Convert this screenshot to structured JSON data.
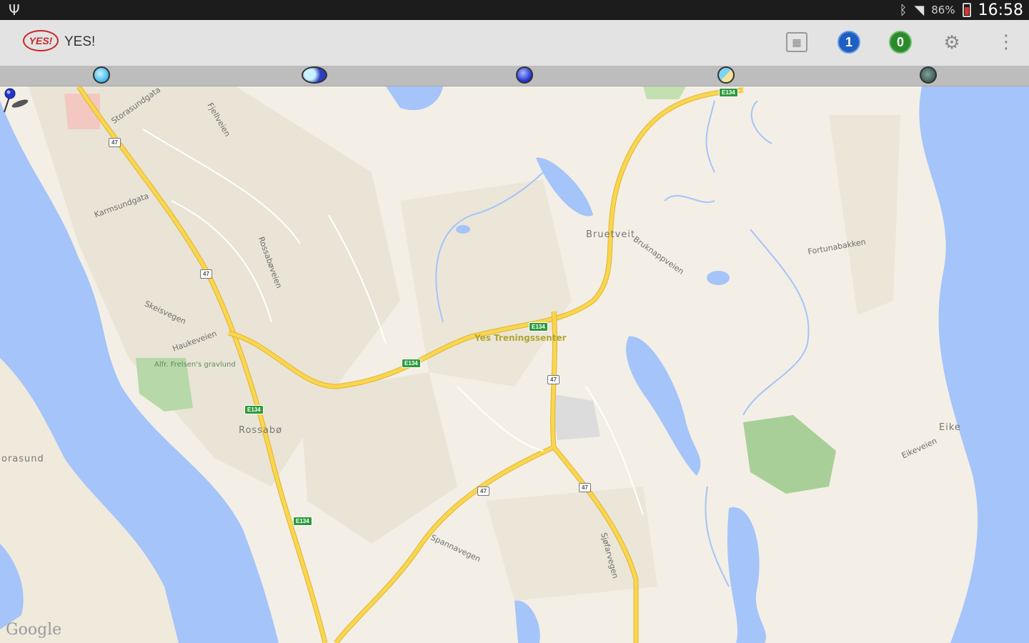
{
  "status_bar": {
    "usb_icon": "usb-icon",
    "bluetooth_icon": "bluetooth-icon",
    "wifi_icon": "wifi-icon",
    "battery_percent": "86%",
    "time": "16:58"
  },
  "action_bar": {
    "logo_text": "YES!",
    "title": "YES!",
    "blue_count": "1",
    "green_count": "0",
    "icons": [
      "chart-icon",
      "gear-icon",
      "overflow-menu-icon"
    ]
  },
  "map": {
    "places": {
      "bruetveit": "Bruetveit",
      "rossabo": "Rossabø",
      "eike": "Eike",
      "karmsund": "orasund"
    },
    "poi": "Yes Treningssenter",
    "park": "Alfr. Frelsen's gravlund",
    "streets": [
      "Storasundgata",
      "Karmsundgata",
      "Fjellveien",
      "Haukeveien",
      "Skeisvegen",
      "Rossabøveien",
      "Spannavegen",
      "Eikeveien",
      "Bruknappveien",
      "Sjøfarvegen",
      "Fortunabakken"
    ],
    "shields": [
      "E134",
      "47",
      "47",
      "E134",
      "E134",
      "E134",
      "47",
      "47",
      "47",
      "E134"
    ],
    "attribution": "Google"
  },
  "colors": {
    "water": "#a5c4f9",
    "land": "#f3efe6",
    "road": "#f9d650",
    "accent_blue": "#1e5fc4",
    "accent_green": "#2c8a2c"
  }
}
